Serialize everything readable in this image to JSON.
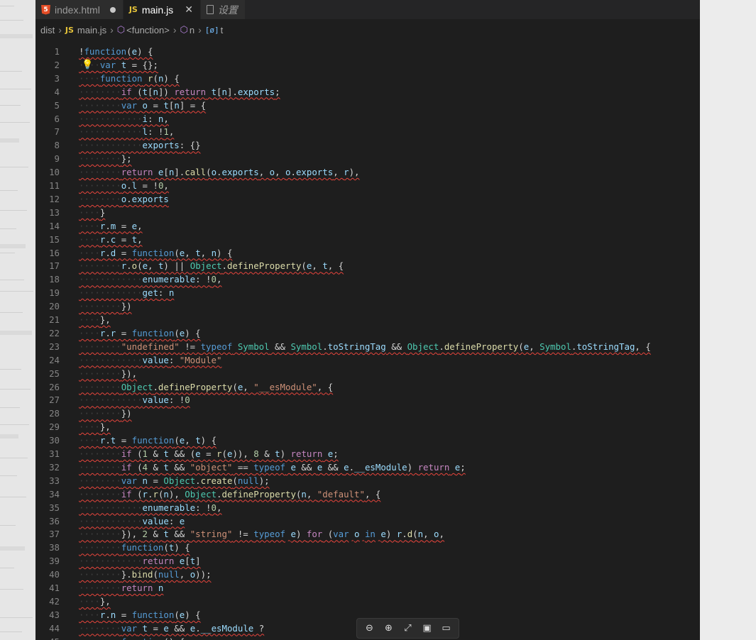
{
  "tabs": [
    {
      "label": "index.html",
      "icon": "html5-icon",
      "icon_glyph": "5",
      "state": "modified"
    },
    {
      "label": "main.js",
      "icon": "js-icon",
      "icon_glyph": "JS",
      "state": "active"
    },
    {
      "label": "设置",
      "icon": "file-icon",
      "state": "inactive"
    }
  ],
  "breadcrumb": {
    "folder": "dist",
    "file_icon": "JS",
    "file": "main.js",
    "scope": "<function>",
    "symbol": "n",
    "var_glyph": "[ø]",
    "variable": "t"
  },
  "code": {
    "lines": [
      "!function(e) {",
      "    var t = {};",
      "    function r(n) {",
      "        if (t[n]) return t[n].exports;",
      "        var o = t[n] = {",
      "            i: n,",
      "            l: !1,",
      "            exports: {}",
      "        };",
      "        return e[n].call(o.exports, o, o.exports, r),",
      "        o.l = !0,",
      "        o.exports",
      "    }",
      "    r.m = e,",
      "    r.c = t,",
      "    r.d = function(e, t, n) {",
      "        r.o(e, t) || Object.defineProperty(e, t, {",
      "            enumerable: !0,",
      "            get: n",
      "        })",
      "    },",
      "    r.r = function(e) {",
      "        \"undefined\" != typeof Symbol && Symbol.toStringTag && Object.defineProperty(e, Symbol.toStringTag, {",
      "            value: \"Module\"",
      "        }),",
      "        Object.defineProperty(e, \"__esModule\", {",
      "            value: !0",
      "        })",
      "    },",
      "    r.t = function(e, t) {",
      "        if (1 & t && (e = r(e)), 8 & t) return e;",
      "        if (4 & t && \"object\" == typeof e && e && e.__esModule) return e;",
      "        var n = Object.create(null);",
      "        if (r.r(n), Object.defineProperty(n, \"default\", {",
      "            enumerable: !0,",
      "            value: e",
      "        }), 2 & t && \"string\" != typeof e) for (var o in e) r.d(n, o,",
      "        function(t) {",
      "            return e[t]",
      "        }.bind(null, o));",
      "        return n",
      "    },",
      "    r.n = function(e) {",
      "        var t = e && e.__esModule ?",
      "        function() {"
    ],
    "lightbulb_line": 2
  },
  "toolbar": {
    "buttons": [
      {
        "name": "zoom-out-button",
        "icon": "zoom-out-icon",
        "glyph": "⊖"
      },
      {
        "name": "zoom-in-button",
        "icon": "zoom-in-icon",
        "glyph": "⊕"
      },
      {
        "name": "fit-button",
        "icon": "expand-icon",
        "glyph": "⤢"
      },
      {
        "name": "screen-button",
        "icon": "screen-icon",
        "glyph": "▣"
      },
      {
        "name": "comment-button",
        "icon": "comment-icon",
        "glyph": "▭"
      }
    ]
  },
  "colors": {
    "editor_bg": "#1e1e1e",
    "keyword": "#569cd6",
    "control": "#c586c0",
    "function": "#dcdcaa",
    "variable": "#9cdcfe",
    "string": "#ce9178",
    "number": "#b5cea8",
    "class": "#4ec9b0",
    "squiggle": "#e8453c"
  }
}
